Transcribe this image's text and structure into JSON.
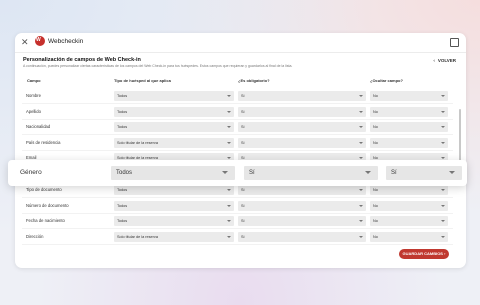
{
  "app": {
    "title": "Webcheckin",
    "logo_mark": "W"
  },
  "page": {
    "heading": "Personalización de campos de Web Check-in",
    "subtext": "A continuación, puedes personalizar ciertas características de los campos del Web Check-in para tus huéspedes. Estos campos que requieran y guardarlos al final de la lista.",
    "back_label": "VOLVER"
  },
  "columns": {
    "field": "Campo",
    "guest_type": "Tipo de huésped al que aplica",
    "mandatory": "¿Es obligatorio?",
    "hide": "¿Ocultar campo?"
  },
  "rows": [
    {
      "label": "Nombre",
      "guest_type": "Todos",
      "mandatory": "Sí",
      "hide": "No"
    },
    {
      "label": "Apellido",
      "guest_type": "Todos",
      "mandatory": "Sí",
      "hide": "No"
    },
    {
      "label": "Nacionalidad",
      "guest_type": "Todos",
      "mandatory": "Sí",
      "hide": "No"
    },
    {
      "label": "País de residencia",
      "guest_type": "Solo titular de la reserva",
      "mandatory": "Sí",
      "hide": "No"
    },
    {
      "label": "Email",
      "guest_type": "Solo titular de la reserva",
      "mandatory": "Sí",
      "hide": "No"
    },
    {
      "label": "Género",
      "guest_type": "Todos",
      "mandatory": "Sí",
      "hide": "Sí"
    },
    {
      "label": "Tipo de documento",
      "guest_type": "Todos",
      "mandatory": "Sí",
      "hide": "No"
    },
    {
      "label": "Número de documento",
      "guest_type": "Todos",
      "mandatory": "Sí",
      "hide": "No"
    },
    {
      "label": "Fecha de nacimiento",
      "guest_type": "Todos",
      "mandatory": "Sí",
      "hide": "No"
    },
    {
      "label": "Dirección",
      "guest_type": "Solo titular de la reserva",
      "mandatory": "Sí",
      "hide": "No"
    }
  ],
  "highlight_row": {
    "label": "Género",
    "guest_type": "Todos",
    "mandatory": "Sí",
    "hide": "Sí"
  },
  "save_label": "GUARDAR CAMBIOS",
  "icons": {
    "window_menu": "settings-icon",
    "back": "arrow-left-icon",
    "save": "arrow-right-icon",
    "dropdown": "chevron-down-icon"
  },
  "colors": {
    "accent": "#c0382f",
    "select_bg": "#ebebeb"
  }
}
